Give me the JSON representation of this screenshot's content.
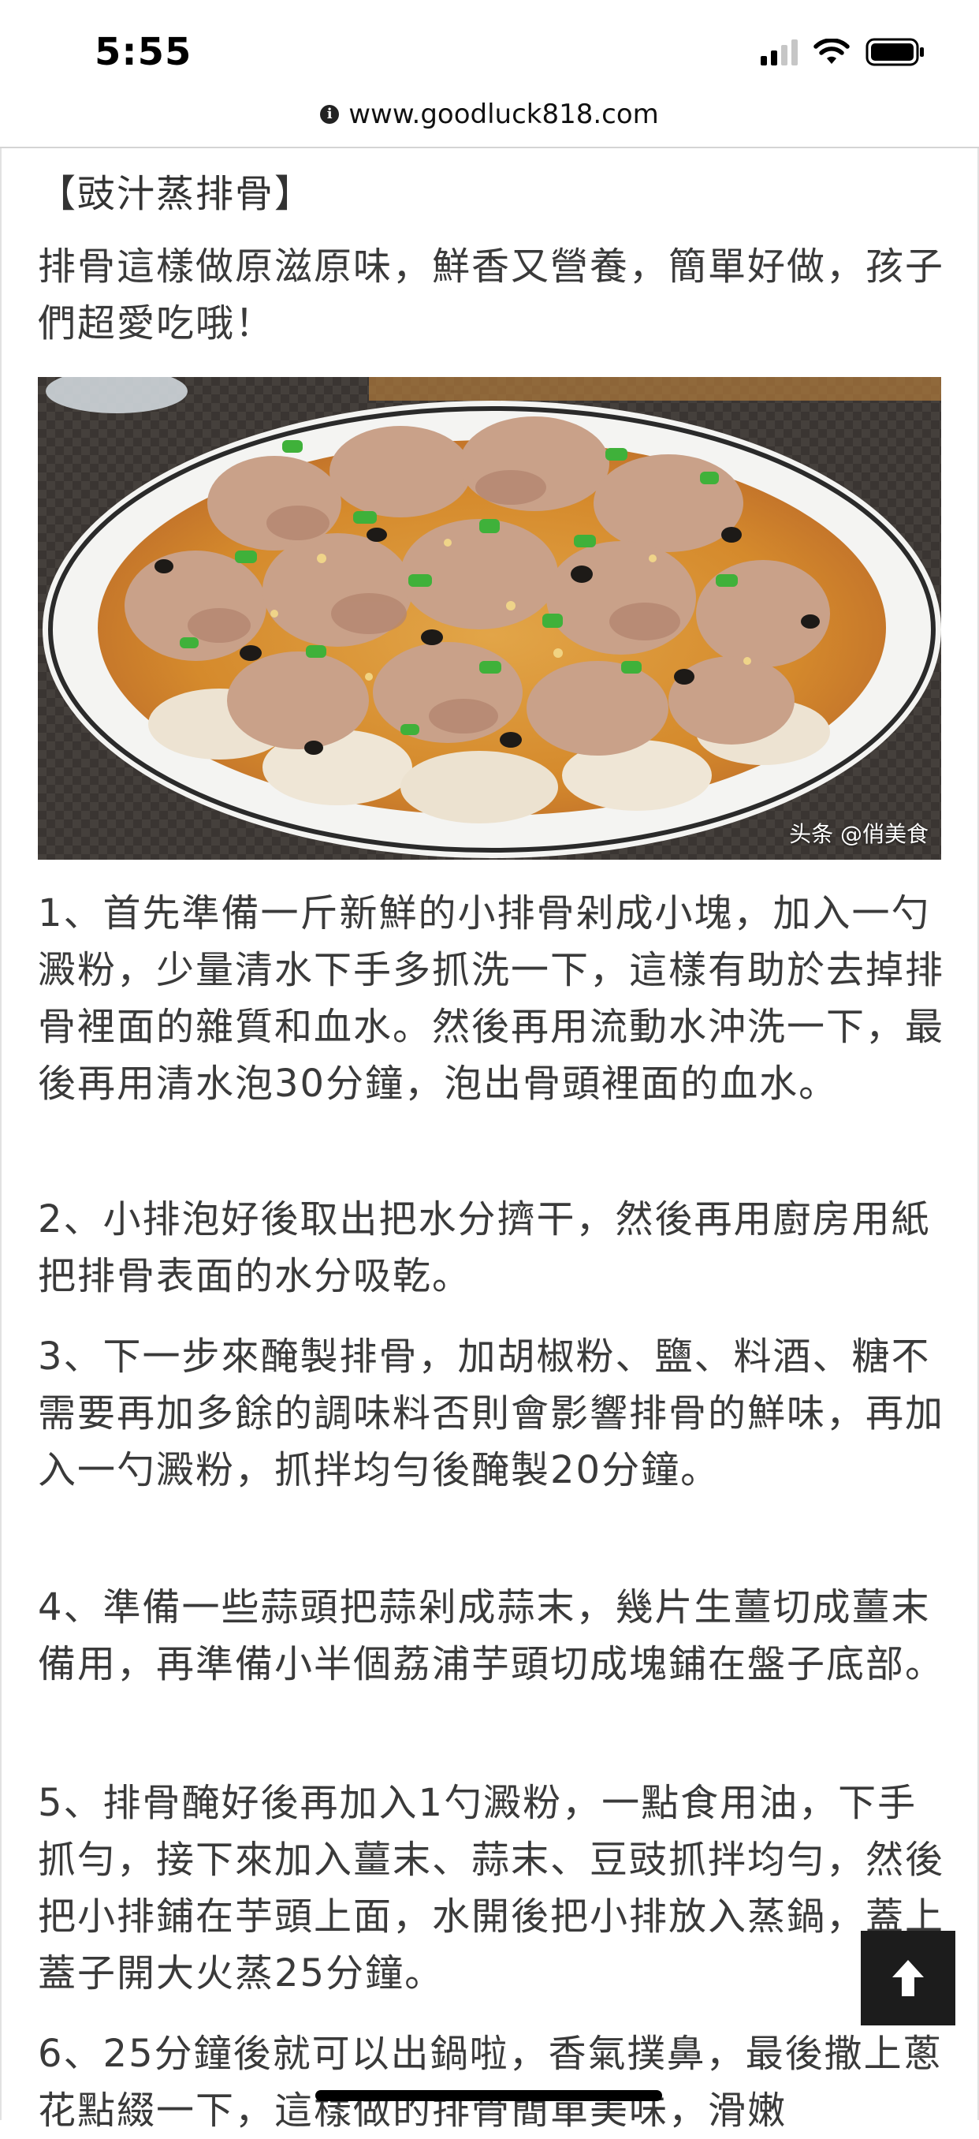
{
  "status_bar": {
    "time": "5:55"
  },
  "browser": {
    "url": "www.goodluck818.com"
  },
  "article": {
    "title": "【豉汁蒸排骨】",
    "intro": "排骨這樣做原滋原味，鮮香又營養，簡單好做，孩子們超愛吃哦！",
    "image_watermark": "头条 @俏美食",
    "steps": [
      "1、首先準備一斤新鮮的小排骨剁成小塊，加入一勺澱粉，少量清水下手多抓洗一下，這樣有助於去掉排骨裡面的雜質和血水。然後再用流動水沖洗一下，最後再用清水泡30分鐘，泡出骨頭裡面的血水。",
      "2、小排泡好後取出把水分擠干，然後再用廚房用紙把排骨表面的水分吸乾。",
      "3、下一步來醃製排骨，加胡椒粉、鹽、料酒、糖不需要再加多餘的調味料否則會影響排骨的鮮味，再加入一勺澱粉，抓拌均勻後醃製20分鐘。",
      "4、準備一些蒜頭把蒜剁成蒜末，幾片生薑切成薑末備用，再準備小半個荔浦芋頭切成塊鋪在盤子底部。",
      "5、排骨醃好後再加入1勺澱粉，一點食用油，下手抓勻，接下來加入薑末、蒜末、豆豉抓拌均勻，然後把小排鋪在芋頭上面，水開後把小排放入蒸鍋，蓋上蓋子開大火蒸25分鐘。",
      "6、25分鐘後就可以出鍋啦，香氣撲鼻，最後撒上蔥花點綴一下，這樣做的排骨簡單美味，滑嫩"
    ]
  },
  "icons": {
    "info": "info-icon",
    "signal": "cellular-signal-icon",
    "wifi": "wifi-icon",
    "battery": "battery-icon",
    "scroll_top": "arrow-up-icon"
  },
  "colors": {
    "text": "#3a3a3a",
    "scroll_button": "#1c1c1c"
  }
}
